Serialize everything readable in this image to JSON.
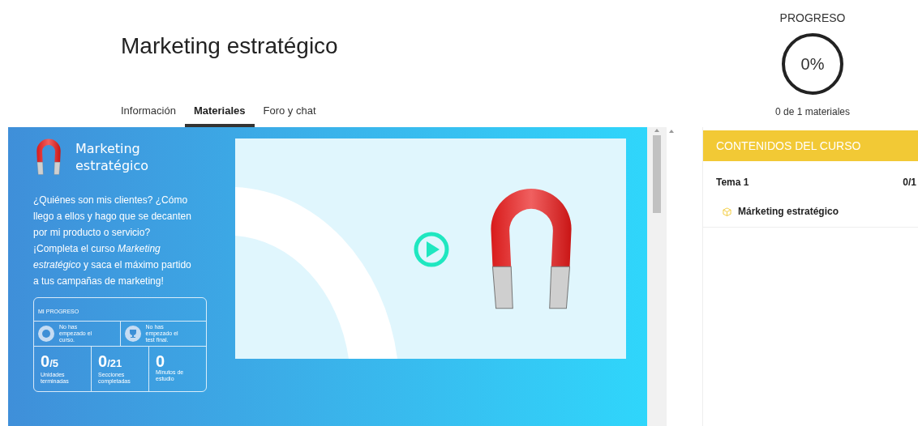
{
  "course": {
    "title": "Marketing estratégico"
  },
  "tabs": [
    {
      "label": "Información",
      "selected": false
    },
    {
      "label": "Materiales",
      "selected": true
    },
    {
      "label": "Foro y chat",
      "selected": false
    }
  ],
  "progress": {
    "heading": "PROGRESO",
    "percent": "0%",
    "level": 0,
    "caption": "0 de 1 materiales"
  },
  "material": {
    "title": "Marketing estratégico",
    "description": "¿Quiénes son mis clientes? ¿Cómo llego a ellos y hago que se decanten por mi producto o servicio? ¡Completa el curso *Marketing estratégico* y saca el máximo partido a tus campañas de marketing!",
    "my_progress": {
      "heading": "MI PROGRESO",
      "statuses": [
        {
          "kind": "course",
          "text": "No has empezado el curso."
        },
        {
          "kind": "test",
          "text": "No has empezado el test final."
        }
      ],
      "stats": [
        {
          "value": "0",
          "total": "/5",
          "label": "Unidades terminadas"
        },
        {
          "value": "0",
          "total": "/21",
          "label": "Secciones completadas"
        },
        {
          "value": "0",
          "label": "Minutos de estudio"
        }
      ]
    }
  },
  "contents": {
    "heading": "CONTENIDOS DEL CURSO",
    "topics": [
      {
        "title": "Tema 1",
        "count": "0/1",
        "children": [
          {
            "title": "Márketing estratégico"
          }
        ]
      }
    ]
  }
}
